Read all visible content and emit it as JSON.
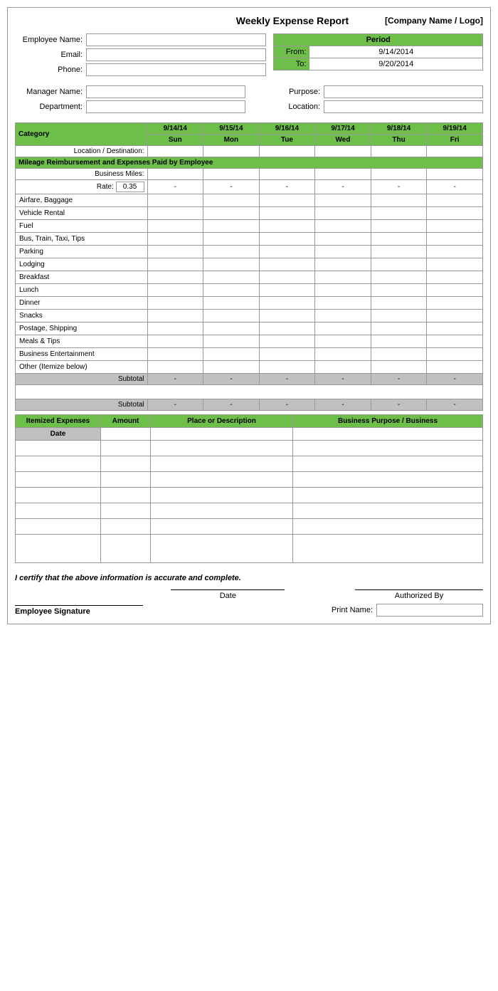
{
  "title": "Weekly Expense Report",
  "company": "[Company Name / Logo]",
  "fields": {
    "employee_name_label": "Employee Name:",
    "email_label": "Email:",
    "phone_label": "Phone:",
    "manager_label": "Manager Name:",
    "department_label": "Department:",
    "purpose_label": "Purpose:",
    "location_label": "Location:"
  },
  "period": {
    "title": "Period",
    "from_label": "From:",
    "from_value": "9/14/2014",
    "to_label": "To:",
    "to_value": "9/20/2014"
  },
  "days": [
    {
      "date": "9/14/14",
      "day": "Sun"
    },
    {
      "date": "9/15/14",
      "day": "Mon"
    },
    {
      "date": "9/16/14",
      "day": "Tue"
    },
    {
      "date": "9/17/14",
      "day": "Wed"
    },
    {
      "date": "9/18/14",
      "day": "Thu"
    },
    {
      "date": "9/19/14",
      "day": "Fri"
    }
  ],
  "location_dest_label": "Location / Destination:",
  "mileage_section": "Mileage Reimbursement and Expenses Paid by Employee",
  "business_miles_label": "Business Miles:",
  "rate_label": "Rate:",
  "rate_value": "0.35",
  "dash": "-",
  "categories": [
    "Airfare, Baggage",
    "Vehicle Rental",
    "Fuel",
    "Bus, Train, Taxi, Tips",
    "Parking",
    "Lodging",
    "Breakfast",
    "Lunch",
    "Dinner",
    "Snacks",
    "Postage, Shipping",
    "Meals & Tips",
    "Business Entertainment",
    "Other (Itemize below)"
  ],
  "subtotal_label": "Subtotal",
  "itemized": {
    "header": "Itemized Expenses",
    "amount": "Amount",
    "place": "Place or Description",
    "business_purpose": "Business Purpose / Business",
    "date_label": "Date"
  },
  "certify_text": "I certify that the above information is accurate and complete.",
  "date_label": "Date",
  "authorized_label": "Authorized By",
  "employee_sig_label": "Employee Signature",
  "print_name_label": "Print Name:"
}
